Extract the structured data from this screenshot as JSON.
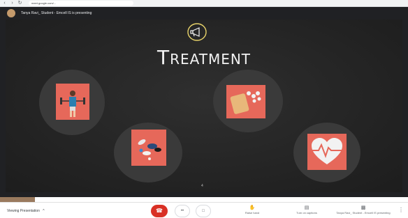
{
  "browser": {
    "url": "meet.google.com/..."
  },
  "presenter": {
    "text": "Tanya Ravi_ Student - Emcell IS is presenting"
  },
  "slide": {
    "title": "Treatment",
    "title_icon": "megaphone-icon",
    "slide_number": "4",
    "cards": [
      {
        "name": "exercise-card",
        "icon": "exercise-icon"
      },
      {
        "name": "pills-card",
        "icon": "pills-icon"
      },
      {
        "name": "medication-card",
        "icon": "medication-icon"
      },
      {
        "name": "heartbeat-card",
        "icon": "heart-icon"
      }
    ],
    "colors": {
      "card": "#e6685a",
      "circle": "#3a3a3a",
      "background": "#262626"
    }
  },
  "toolbar": {
    "viewing_label": "Viewing Presentation",
    "raise_hand": "Raise hand",
    "turn_on_captions": "Turn on captions",
    "presenter_label": "Tanya Ravi_ Student - Emcell IS presenting",
    "end_call_color": "#d93025"
  }
}
